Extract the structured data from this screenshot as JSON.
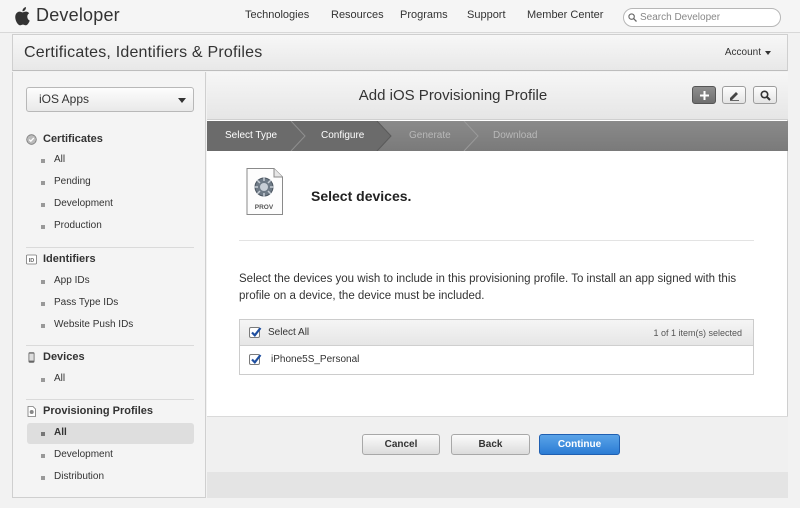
{
  "topnav": {
    "brand": "Developer",
    "links": [
      "Technologies",
      "Resources",
      "Programs",
      "Support",
      "Member Center"
    ],
    "search_placeholder": "Search Developer"
  },
  "titlebar": {
    "title": "Certificates, Identifiers & Profiles",
    "account": "Account"
  },
  "sidebar": {
    "platform": "iOS Apps",
    "sections": {
      "certificates": {
        "title": "Certificates",
        "items": [
          "All",
          "Pending",
          "Development",
          "Production"
        ]
      },
      "identifiers": {
        "title": "Identifiers",
        "icon_text": "ID",
        "items": [
          "App IDs",
          "Pass Type IDs",
          "Website Push IDs"
        ]
      },
      "devices": {
        "title": "Devices",
        "items": [
          "All"
        ]
      },
      "profiles": {
        "title": "Provisioning Profiles",
        "items": [
          "All",
          "Development",
          "Distribution"
        ]
      }
    }
  },
  "main": {
    "title": "Add iOS Provisioning Profile",
    "steps": [
      "Select Type",
      "Configure",
      "Generate",
      "Download"
    ],
    "prov_label": "PROV",
    "heading": "Select devices.",
    "description": "Select the devices you wish to include in this provisioning profile. To install an app signed with this profile on a device, the device must be included.",
    "table": {
      "select_all": "Select All",
      "count": "1 of 1 item(s) selected",
      "rows": [
        "iPhone5S_Personal"
      ]
    },
    "buttons": {
      "cancel": "Cancel",
      "back": "Back",
      "continue": "Continue"
    }
  },
  "colors": {
    "accent_blue": "#2b7cd4",
    "steps_active": "#6a6a6a",
    "steps_bg": "#7f7f7f"
  }
}
